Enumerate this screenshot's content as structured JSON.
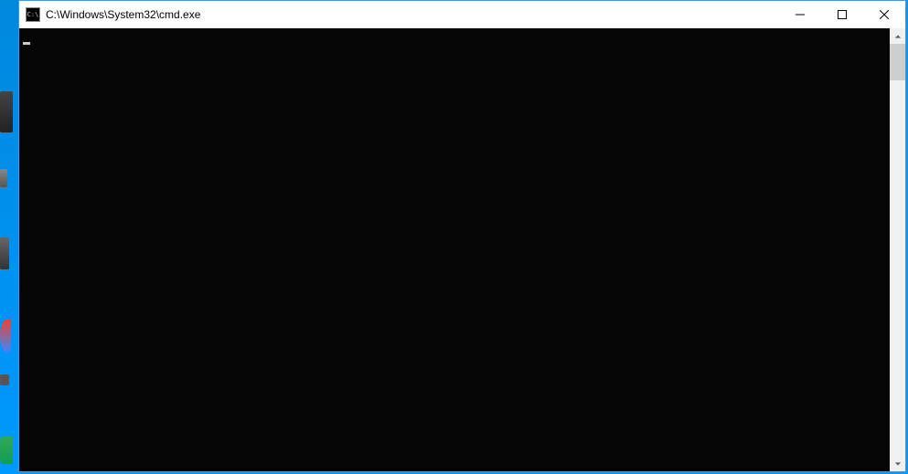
{
  "window": {
    "icon_text": "C:\\",
    "title": "C:\\Windows\\System32\\cmd.exe"
  },
  "terminal": {
    "content": ""
  }
}
